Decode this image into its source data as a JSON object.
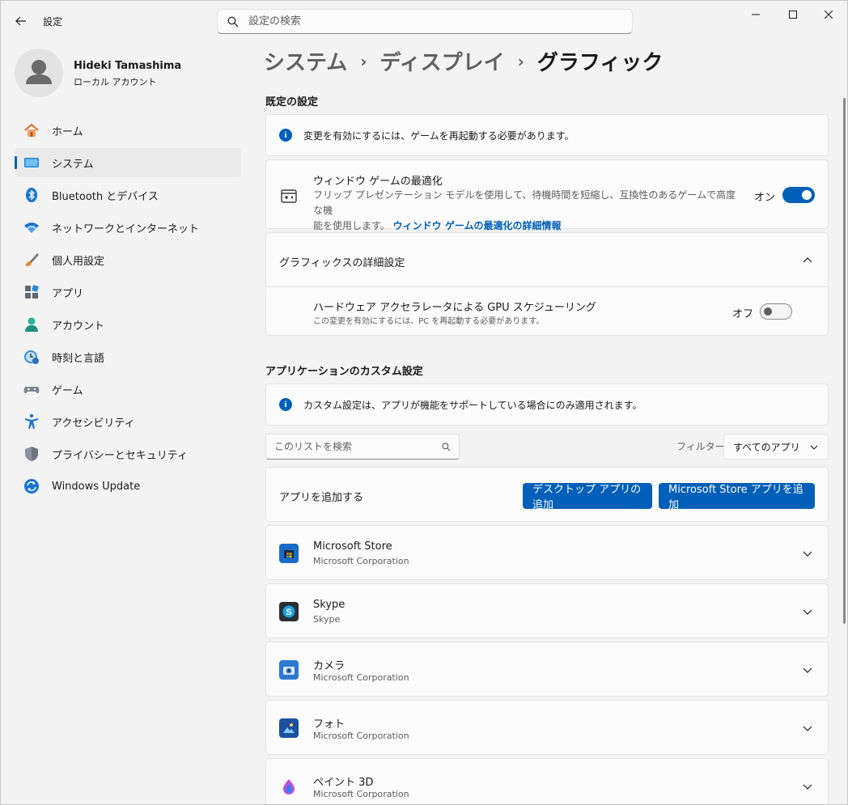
{
  "window": {
    "title": "設定",
    "search_placeholder": "設定の検索"
  },
  "profile": {
    "name": "Hideki Tamashima",
    "account_type": "ローカル アカウント"
  },
  "sidebar": {
    "items": [
      {
        "label": "ホーム",
        "icon": "home-icon"
      },
      {
        "label": "システム",
        "icon": "system-icon",
        "selected": true
      },
      {
        "label": "Bluetooth とデバイス",
        "icon": "bluetooth-icon"
      },
      {
        "label": "ネットワークとインターネット",
        "icon": "network-icon"
      },
      {
        "label": "個人用設定",
        "icon": "brush-icon"
      },
      {
        "label": "アプリ",
        "icon": "apps-icon"
      },
      {
        "label": "アカウント",
        "icon": "account-icon"
      },
      {
        "label": "時刻と言語",
        "icon": "time-language-icon"
      },
      {
        "label": "ゲーム",
        "icon": "gamepad-icon"
      },
      {
        "label": "アクセシビリティ",
        "icon": "accessibility-icon"
      },
      {
        "label": "プライバシーとセキュリティ",
        "icon": "shield-icon"
      },
      {
        "label": "Windows Update",
        "icon": "update-icon"
      }
    ]
  },
  "breadcrumb": {
    "items": [
      "システム",
      "ディスプレイ",
      "グラフィック"
    ],
    "separator": "›"
  },
  "defaults": {
    "section_title": "既定の設定",
    "info_text": "変更を有効にするには、ゲームを再起動する必要があります。",
    "window_game": {
      "title": "ウィンドウ ゲームの最適化",
      "desc": "フリップ プレゼンテーション モデルを使用して、待機時間を短縮し、互換性のあるゲームで高度な機",
      "desc2": "能を使用します。",
      "link": "ウィンドウ ゲームの最適化の詳細情報",
      "state_label": "オン",
      "on": true
    },
    "advanced": {
      "title": "グラフィックスの詳細設定",
      "gpu_title": "ハードウェア アクセラレータによる GPU スケジューリング",
      "gpu_desc": "この変更を有効にするには、PC を再起動する必要があります。",
      "state_label": "オフ",
      "on": false
    }
  },
  "custom": {
    "section_title": "アプリケーションのカスタム設定",
    "info_text": "カスタム設定は、アプリが機能をサポートしている場合にのみ適用されます。",
    "list_search_placeholder": "このリストを検索",
    "filter_label": "フィルター:",
    "filter_value": "すべてのアプリ",
    "add_app_label": "アプリを追加する",
    "add_desktop_button": "デスクトップ アプリの追加",
    "add_store_button": "Microsoft Store アプリを追加",
    "apps": [
      {
        "name": "Microsoft Store",
        "publisher": "Microsoft Corporation",
        "icon": "microsoft-store-icon"
      },
      {
        "name": "Skype",
        "publisher": "Skype",
        "icon": "skype-icon"
      },
      {
        "name": "カメラ",
        "publisher": "Microsoft Corporation",
        "icon": "camera-icon"
      },
      {
        "name": "フォト",
        "publisher": "Microsoft Corporation",
        "icon": "photos-icon"
      },
      {
        "name": "ペイント 3D",
        "publisher": "Microsoft Corporation",
        "icon": "paint3d-icon"
      }
    ]
  },
  "colors": {
    "accent": "#005fb8",
    "background": "#f3f3f3",
    "card": "#fbfbfb"
  }
}
